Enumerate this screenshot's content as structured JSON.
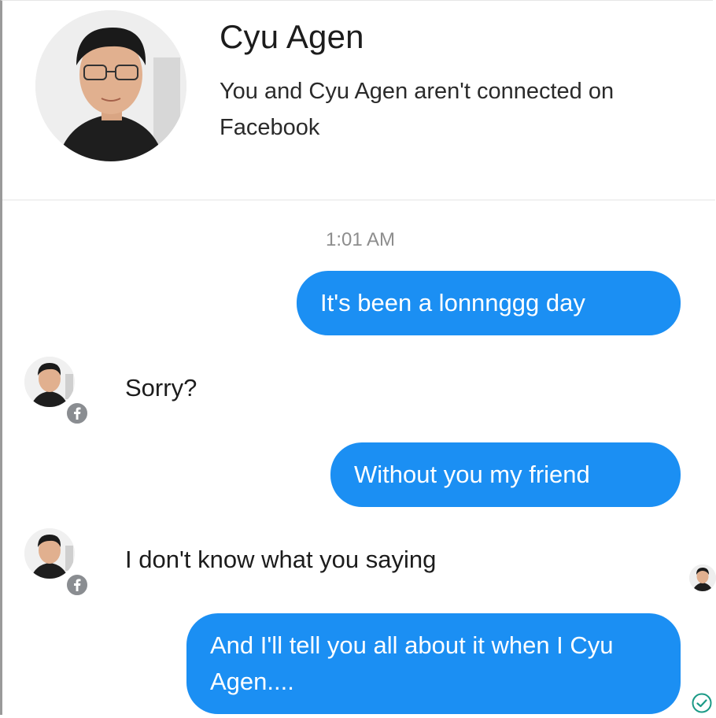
{
  "header": {
    "contact_name": "Cyu Agen",
    "connection_note": "You and Cyu Agen aren't connected on Facebook"
  },
  "conversation": {
    "timestamp": "1:01 AM",
    "messages": [
      {
        "direction": "outgoing",
        "text": "It's been a lonnnggg day"
      },
      {
        "direction": "incoming",
        "text": "Sorry?"
      },
      {
        "direction": "outgoing",
        "text": "Without you my friend"
      },
      {
        "direction": "incoming",
        "text": "I don't know what you saying"
      },
      {
        "direction": "outgoing",
        "text": "And I'll tell you all about it when I Cyu Agen...."
      }
    ]
  },
  "colors": {
    "outgoing_bubble": "#1b8ff3",
    "outgoing_text": "#ffffff",
    "incoming_text": "#1c1c1c",
    "timestamp": "#8d8d8d"
  },
  "icons": {
    "profile": "profile-avatar",
    "facebook_badge": "facebook-badge-icon",
    "read_receipt": "read-receipt-avatar",
    "delivered": "delivered-check-icon"
  }
}
